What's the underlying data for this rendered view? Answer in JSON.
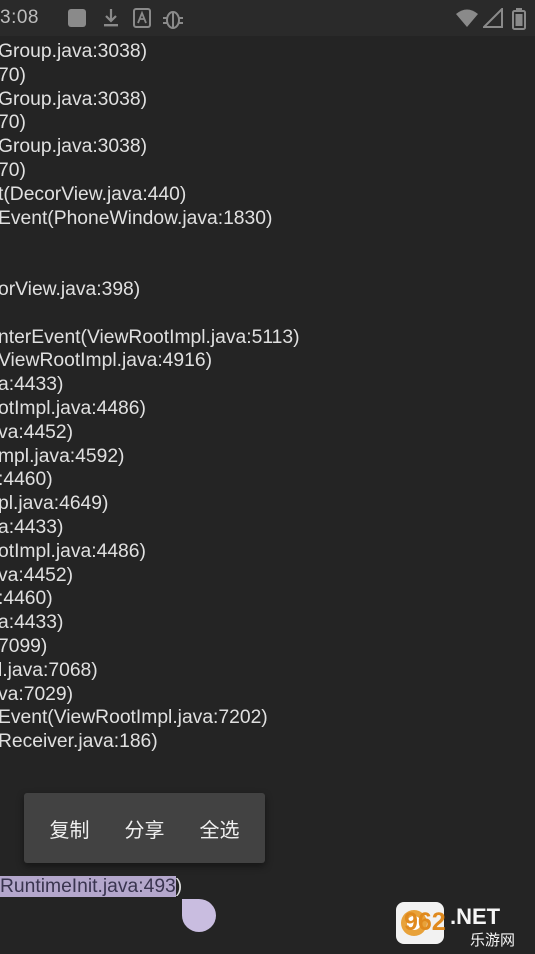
{
  "status_bar": {
    "time": "3:08",
    "icons": [
      "app-icon",
      "download-icon",
      "a-icon",
      "bug-icon",
      "wifi-icon",
      "signal-icon",
      "battery-icon"
    ]
  },
  "log_lines": [
    "Group.java:3038)",
    "70)",
    "Group.java:3038)",
    "70)",
    "Group.java:3038)",
    "70)",
    "t(DecorView.java:440)",
    "Event(PhoneWindow.java:1830)",
    "",
    "",
    "orView.java:398)",
    "",
    "nterEvent(ViewRootImpl.java:5113)",
    "ViewRootImpl.java:4916)",
    "a:4433)",
    "otImpl.java:4486)",
    "va:4452)",
    "mpl.java:4592)",
    ":4460)",
    "pl.java:4649)",
    "a:4433)",
    "otImpl.java:4486)",
    "va:4452)",
    ":4460)",
    "a:4433)",
    "7099)",
    "l.java:7068)",
    "va:7029)",
    "Event(ViewRootImpl.java:7202)",
    "Receiver.java:186)"
  ],
  "context_menu": {
    "copy": "复制",
    "share": "分享",
    "select_all": "全选"
  },
  "selected_line": {
    "selected_text": "RuntimeInit.java:493",
    "rest": ")"
  },
  "watermark": {
    "brand": "962",
    "net": ".NET",
    "sub": "乐游网"
  }
}
